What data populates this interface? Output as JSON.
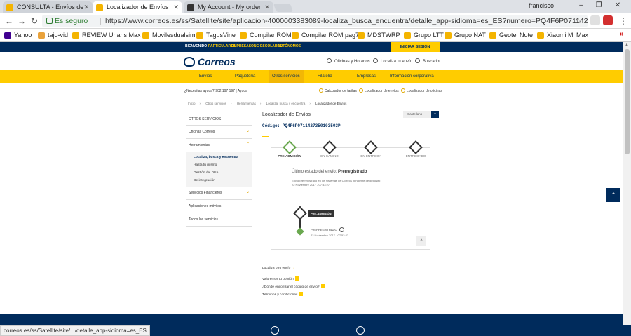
{
  "browser": {
    "tabs": [
      {
        "title": "CONSULTA - Envíos de ",
        "active": false,
        "color": "#f4b400"
      },
      {
        "title": "Localizador de Envíos",
        "active": true,
        "color": "#f4b400"
      },
      {
        "title": "My Account - My order",
        "active": false,
        "color": "#333333"
      }
    ],
    "user": "francisco",
    "secure_label": "Es seguro",
    "url": "https://www.correos.es/ss/Satellite/site/aplicacion-4000003383089-localiza_busca_encuentra/detalle_app-sidioma=es_ES?numero=PQ4F6P0711427350103503P#0",
    "bookmarks": [
      "Yahoo",
      "tajo-vid",
      "REVIEW Uhans Max 2",
      "Movilesdualsim",
      "TagusVine",
      "Compilar ROM",
      "Compilar ROM pag7",
      "MDSTWRP",
      "Grupo LTT",
      "Grupo NAT",
      "Geotel Note",
      "Xiaomi Mi Max"
    ],
    "more": "»"
  },
  "site": {
    "topbar_links": [
      "BIENVENIDO",
      "PARTICULARES",
      "EMPRESAS",
      "ONG·ESCOLARES",
      "AUTÓNOMOS"
    ],
    "login": "INICIAR SESIÓN",
    "logo": "Correos",
    "header_links": [
      "Oficinas y Horarios",
      "Localiza tu envío",
      "Buscador"
    ],
    "menu": [
      "Envíos",
      "Paquetería",
      "Otros servicios",
      "Filatelia",
      "Empresas",
      "Información corporativa"
    ],
    "menu_active": "Otros servicios",
    "help_text": "¿Necesitas ayuda?  902 197 197  |  Ayuda",
    "utility_links": [
      "Calculador de tarifas",
      "Localizador de envíos",
      "Localizador de oficinas"
    ],
    "breadcrumb": [
      "Inicio",
      "Otros servicios",
      "Herramientas",
      "Localiza, busca y encuentra",
      "Localizador de Envíos"
    ]
  },
  "sidebar": {
    "heading": "OTROS SERVICIOS",
    "items": [
      {
        "label": "Oficinas Correos",
        "chevron": true
      },
      {
        "label": "Herramientas",
        "chevron": true
      }
    ],
    "subitems": [
      "Localiza, busca y encuentra",
      "Hasta tu mismo",
      "Gestión del DUA",
      "De integración"
    ],
    "items_after": [
      {
        "label": "Servicios Financieros",
        "chevron": true
      },
      {
        "label": "Aplicaciones móviles",
        "chevron": false
      },
      {
        "label": "Todos los servicios",
        "chevron": false
      }
    ]
  },
  "main": {
    "title": "Localizador de Envíos",
    "category_placeholder": "Castellano",
    "code_label": "Código: PQ4F6P0711427350103503P",
    "steps": [
      "PRE-ADMISIÓN",
      "EN CAMINO",
      "EN ENTREGA",
      "ENTREGADO"
    ],
    "last_status_label": "Último estado del envío:",
    "last_status_value": "Prerregistrado",
    "status_desc": "Envío prerregistrado en los sistemas de Correos pendiente de depósito",
    "status_date": "22 Noviembre 2017 - 07:53:27",
    "timeline_tag": "PRE-ADMISIÓN",
    "event_label": "PRERREGISTRADO",
    "event_date": "22 Noviembre 2017 - 07:53:27",
    "collapse_icon": "^",
    "links": [
      "Localiza otro envío",
      "Valoremos tu opinión",
      "¿Dónde encontrar el código de envío?",
      "Términos y condiciones"
    ]
  },
  "status_bar": "correos.es/ss/Satellite/site/.../detalle_app-sidioma=es_ES",
  "colors": {
    "brand_blue": "#002b5c",
    "brand_yellow": "#ffcc00",
    "active_green": "#6aa84f"
  }
}
